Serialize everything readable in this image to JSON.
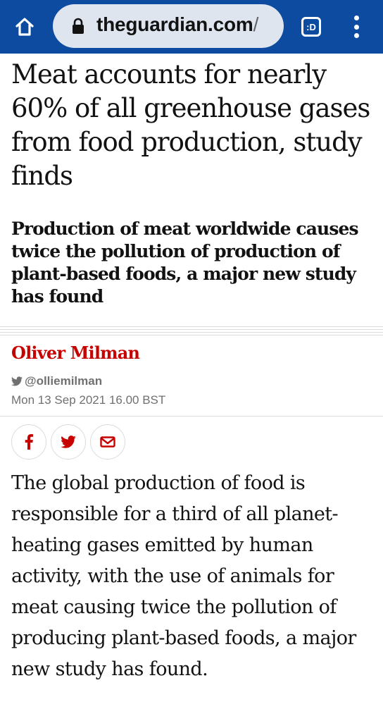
{
  "browser": {
    "url_host": "theguardian.com",
    "url_path": "/",
    "tab_label": ":D",
    "icons": [
      "home-icon",
      "lock-icon",
      "tab-switcher-icon",
      "more-menu-icon"
    ],
    "colors": {
      "toolbar": "#0c4ba0",
      "urlbar": "#dfe5ef"
    }
  },
  "article": {
    "headline": "Meat accounts for nearly 60% of all greenhouse gases from food production, study finds",
    "standfirst": "Production of meat worldwide causes twice the pollution of production of plant-based foods, a major new study has found",
    "byline": "Oliver Milman",
    "twitter_handle": "@olliemilman",
    "published": "Mon 13 Sep 2021 16.00 BST",
    "share": [
      "facebook-icon",
      "twitter-icon",
      "email-icon"
    ],
    "body": "The global production of food is responsible for a third of all planet-heating gases emitted by human activity, with the use of animals for meat causing twice the pollution of producing plant-based foods, a major new study has found.",
    "colors": {
      "byline": "#c70000",
      "meta": "#707070",
      "text": "#121212"
    }
  }
}
